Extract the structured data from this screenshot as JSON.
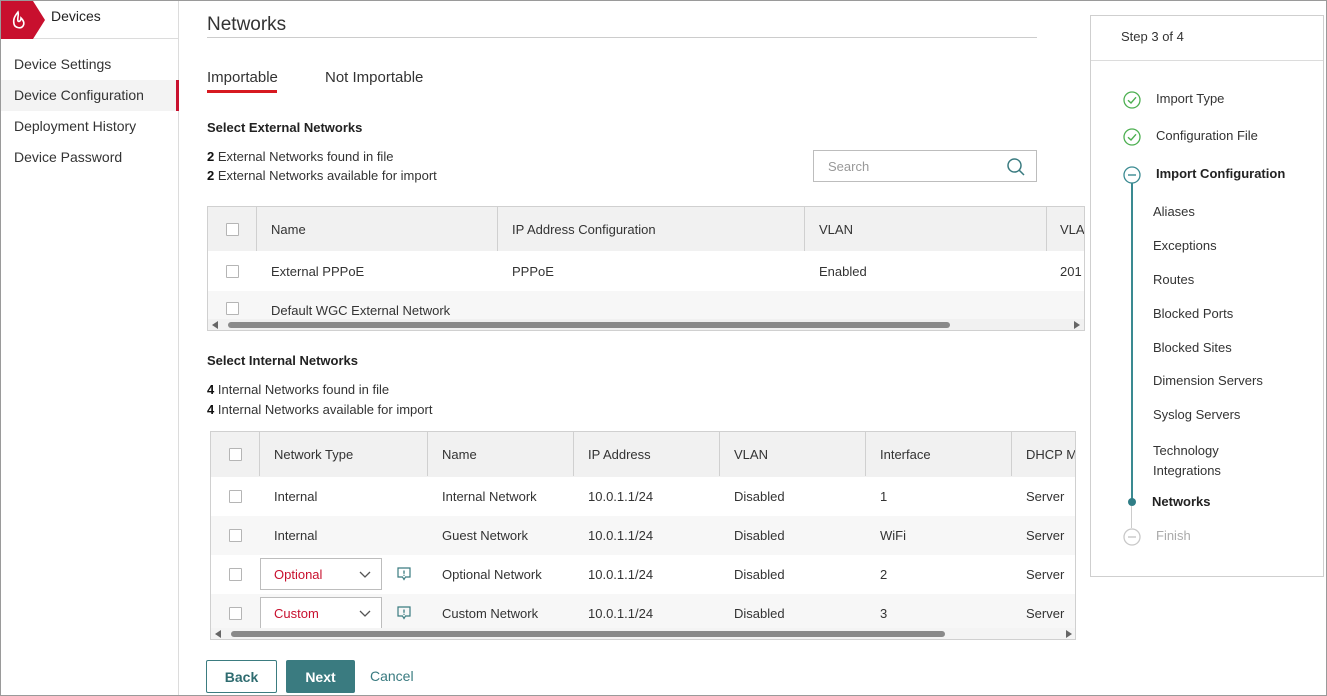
{
  "sidebar": {
    "brand_label": "Devices",
    "items": [
      {
        "label": "Device Settings"
      },
      {
        "label": "Device Configuration"
      },
      {
        "label": "Deployment History"
      },
      {
        "label": "Device Password"
      }
    ],
    "active_item": "Device Configuration"
  },
  "page": {
    "title": "Networks",
    "tabs": [
      {
        "label": "Importable",
        "active": true
      },
      {
        "label": "Not Importable",
        "active": false
      }
    ]
  },
  "external": {
    "heading": "Select External Networks",
    "found_count": "2",
    "found_text": "External Networks found in file",
    "available_count": "2",
    "available_text": "External Networks available for import",
    "search_placeholder": "Search",
    "columns": [
      "Name",
      "IP Address Configuration",
      "VLAN",
      "VLA"
    ],
    "rows": [
      {
        "name": "External PPPoE",
        "ip_config": "PPPoE",
        "vlan": "Enabled",
        "vlan_id": "201"
      },
      {
        "name": "Default WGC External Network",
        "ip_config": "",
        "vlan": "",
        "vlan_id": ""
      }
    ]
  },
  "internal": {
    "heading": "Select Internal Networks",
    "found_count": "4",
    "found_text": "Internal Networks found in file",
    "available_count": "4",
    "available_text": "Internal Networks available for import",
    "columns": [
      "Network Type",
      "Name",
      "IP Address",
      "VLAN",
      "Interface",
      "DHCP M"
    ],
    "rows": [
      {
        "type": "Internal",
        "name": "Internal Network",
        "ip": "10.0.1.1/24",
        "vlan": "Disabled",
        "interface": "1",
        "dhcp": "Server"
      },
      {
        "type": "Internal",
        "name": "Guest Network",
        "ip": "10.0.1.1/24",
        "vlan": "Disabled",
        "interface": "WiFi",
        "dhcp": "Server"
      },
      {
        "type": "Optional",
        "name": "Optional Network",
        "ip": "10.0.1.1/24",
        "vlan": "Disabled",
        "interface": "2",
        "dhcp": "Server"
      },
      {
        "type": "Custom",
        "name": "Custom Network",
        "ip": "10.0.1.1/24",
        "vlan": "Disabled",
        "interface": "3",
        "dhcp": "Server"
      }
    ]
  },
  "buttons": {
    "back": "Back",
    "next": "Next",
    "cancel": "Cancel"
  },
  "wizard": {
    "step_label": "Step 3 of 4",
    "steps": [
      {
        "label": "Import Type",
        "state": "complete"
      },
      {
        "label": "Configuration File",
        "state": "complete"
      },
      {
        "label": "Import Configuration",
        "state": "current"
      },
      {
        "label": "Finish",
        "state": "pending"
      }
    ],
    "substeps": [
      {
        "label": "Aliases"
      },
      {
        "label": "Exceptions"
      },
      {
        "label": "Routes"
      },
      {
        "label": "Blocked Ports"
      },
      {
        "label": "Blocked Sites"
      },
      {
        "label": "Dimension Servers"
      },
      {
        "label": "Syslog Servers"
      },
      {
        "label": "Technology Integrations"
      },
      {
        "label": "Networks",
        "current": true
      }
    ]
  },
  "colors": {
    "accent_red": "#c8102e",
    "teal": "#3a7b80",
    "check_green": "#4caf50"
  }
}
